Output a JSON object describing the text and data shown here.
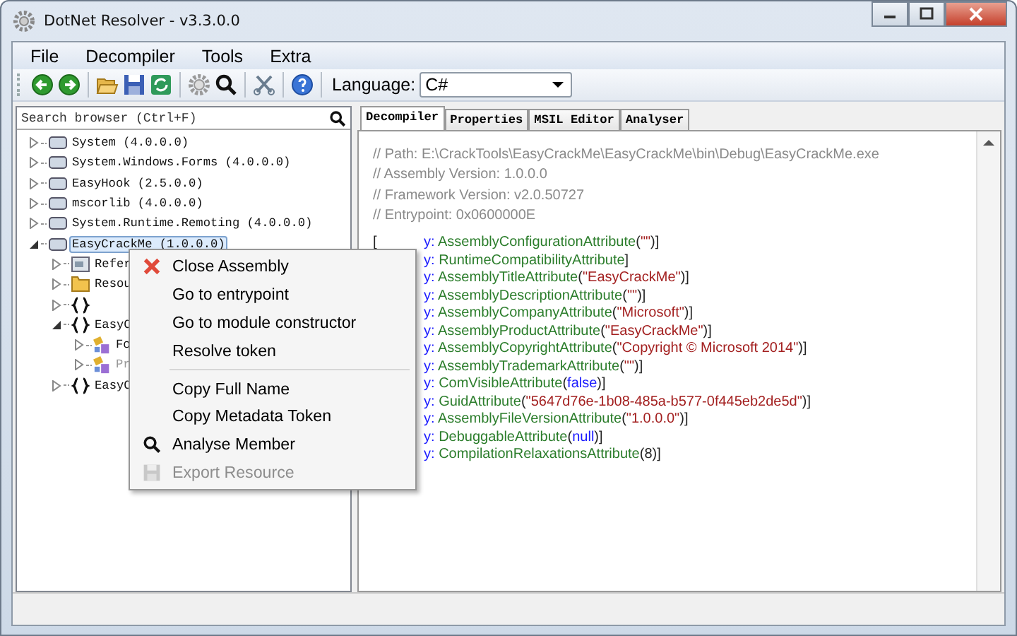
{
  "window": {
    "title": "DotNet Resolver - v3.3.0.0"
  },
  "menu_bar": [
    "File",
    "Decompiler",
    "Tools",
    "Extra"
  ],
  "toolbar": {
    "buttons": [
      {
        "kind": "back"
      },
      {
        "kind": "forward"
      },
      {
        "kind": "sep"
      },
      {
        "kind": "open"
      },
      {
        "kind": "save"
      },
      {
        "kind": "refresh"
      },
      {
        "kind": "sep"
      },
      {
        "kind": "settings"
      },
      {
        "kind": "search"
      },
      {
        "kind": "sep"
      },
      {
        "kind": "tools"
      },
      {
        "kind": "sep"
      },
      {
        "kind": "help"
      },
      {
        "kind": "sep"
      }
    ],
    "language_label": "Language:",
    "language_value": "C#"
  },
  "search": {
    "placeholder": "Search browser (Ctrl+F)"
  },
  "tree": [
    {
      "label": "System (4.0.0.0)",
      "kind": "assembly",
      "expanded": false,
      "selected": false
    },
    {
      "label": "System.Windows.Forms (4.0.0.0)",
      "kind": "assembly",
      "expanded": false,
      "selected": false
    },
    {
      "label": "EasyHook (2.5.0.0)",
      "kind": "assembly",
      "expanded": false,
      "selected": false
    },
    {
      "label": "mscorlib (4.0.0.0)",
      "kind": "assembly",
      "expanded": false,
      "selected": false
    },
    {
      "label": "System.Runtime.Remoting (4.0.0.0)",
      "kind": "assembly",
      "expanded": false,
      "selected": false
    },
    {
      "label": "EasyCrackMe (1.0.0.0)",
      "kind": "assembly",
      "expanded": true,
      "selected": true,
      "children": [
        {
          "label": "Refer",
          "kind": "references",
          "expanded": false,
          "selected": false
        },
        {
          "label": "Resou",
          "kind": "folder",
          "expanded": false,
          "selected": false
        },
        {
          "kind": "namespace",
          "expanded": false,
          "selected": false
        },
        {
          "label": "EasyC",
          "kind": "namespace",
          "expanded": true,
          "selected": false,
          "children": [
            {
              "label": "Fo",
              "kind": "class",
              "expanded": false,
              "selected": false,
              "dimmed": false
            },
            {
              "label": "Pr",
              "kind": "class",
              "expanded": false,
              "selected": false,
              "dimmed": true
            }
          ]
        },
        {
          "label": "EasyC",
          "kind": "namespace",
          "expanded": false,
          "selected": false
        }
      ]
    }
  ],
  "tabs": [
    {
      "label": "Decompiler",
      "selected": true
    },
    {
      "label": "Properties",
      "selected": false
    },
    {
      "label": "MSIL Editor",
      "selected": false
    },
    {
      "label": "Analyser",
      "selected": false
    }
  ],
  "comments": [
    "// Path: E:\\CrackTools\\EasyCrackMe\\EasyCrackMe\\bin\\Debug\\EasyCrackMe.exe",
    "// Assembly Version: 1.0.0.0",
    "// Framework Version: v2.0.50727",
    "// Entrypoint: 0x0600000E"
  ],
  "code_lines": [
    {
      "lead": "[",
      "tokens": [
        {
          "kind": "keyword",
          "text": "y: "
        },
        {
          "kind": "type",
          "text": "AssemblyConfigurationAttribute"
        },
        {
          "kind": "punct",
          "text": "("
        },
        {
          "kind": "string",
          "text": "\"\""
        },
        {
          "kind": "punct",
          "text": ")]"
        }
      ]
    },
    {
      "tokens": [
        {
          "kind": "keyword",
          "text": "y: "
        },
        {
          "kind": "type",
          "text": "RuntimeCompatibilityAttribute"
        },
        {
          "kind": "punct",
          "text": "]"
        }
      ]
    },
    {
      "tokens": [
        {
          "kind": "keyword",
          "text": "y: "
        },
        {
          "kind": "type",
          "text": "AssemblyTitleAttribute"
        },
        {
          "kind": "punct",
          "text": "("
        },
        {
          "kind": "string",
          "text": "\"EasyCrackMe\""
        },
        {
          "kind": "punct",
          "text": ")]"
        }
      ]
    },
    {
      "tokens": [
        {
          "kind": "keyword",
          "text": "y: "
        },
        {
          "kind": "type",
          "text": "AssemblyDescriptionAttribute"
        },
        {
          "kind": "punct",
          "text": "("
        },
        {
          "kind": "string",
          "text": "\"\""
        },
        {
          "kind": "punct",
          "text": ")]"
        }
      ]
    },
    {
      "tokens": [
        {
          "kind": "keyword",
          "text": "y: "
        },
        {
          "kind": "type",
          "text": "AssemblyCompanyAttribute"
        },
        {
          "kind": "punct",
          "text": "("
        },
        {
          "kind": "string",
          "text": "\"Microsoft\""
        },
        {
          "kind": "punct",
          "text": ")]"
        }
      ]
    },
    {
      "tokens": [
        {
          "kind": "keyword",
          "text": "y: "
        },
        {
          "kind": "type",
          "text": "AssemblyProductAttribute"
        },
        {
          "kind": "punct",
          "text": "("
        },
        {
          "kind": "string",
          "text": "\"EasyCrackMe\""
        },
        {
          "kind": "punct",
          "text": ")]"
        }
      ]
    },
    {
      "tokens": [
        {
          "kind": "keyword",
          "text": "y: "
        },
        {
          "kind": "type",
          "text": "AssemblyCopyrightAttribute"
        },
        {
          "kind": "punct",
          "text": "("
        },
        {
          "kind": "string",
          "text": "\"Copyright © Microsoft 2014\""
        },
        {
          "kind": "punct",
          "text": ")]"
        }
      ]
    },
    {
      "tokens": [
        {
          "kind": "keyword",
          "text": "y: "
        },
        {
          "kind": "type",
          "text": "AssemblyTrademarkAttribute"
        },
        {
          "kind": "punct",
          "text": "("
        },
        {
          "kind": "string",
          "text": "\"\""
        },
        {
          "kind": "punct",
          "text": ")]"
        }
      ]
    },
    {
      "tokens": [
        {
          "kind": "keyword",
          "text": "y: "
        },
        {
          "kind": "type",
          "text": "ComVisibleAttribute"
        },
        {
          "kind": "punct",
          "text": "("
        },
        {
          "kind": "keyword",
          "text": "false"
        },
        {
          "kind": "punct",
          "text": ")]"
        }
      ]
    },
    {
      "tokens": [
        {
          "kind": "keyword",
          "text": "y: "
        },
        {
          "kind": "type",
          "text": "GuidAttribute"
        },
        {
          "kind": "punct",
          "text": "("
        },
        {
          "kind": "string",
          "text": "\"5647d76e-1b08-485a-b577-0f445eb2de5d\""
        },
        {
          "kind": "punct",
          "text": ")]"
        }
      ]
    },
    {
      "tokens": [
        {
          "kind": "keyword",
          "text": "y: "
        },
        {
          "kind": "type",
          "text": "AssemblyFileVersionAttribute"
        },
        {
          "kind": "punct",
          "text": "("
        },
        {
          "kind": "string",
          "text": "\"1.0.0.0\""
        },
        {
          "kind": "punct",
          "text": ")]"
        }
      ]
    },
    {
      "tokens": [
        {
          "kind": "keyword",
          "text": "y: "
        },
        {
          "kind": "type",
          "text": "DebuggableAttribute"
        },
        {
          "kind": "punct",
          "text": "("
        },
        {
          "kind": "keyword",
          "text": "null"
        },
        {
          "kind": "punct",
          "text": ")]"
        }
      ]
    },
    {
      "tokens": [
        {
          "kind": "keyword",
          "text": "y: "
        },
        {
          "kind": "type",
          "text": "CompilationRelaxationsAttribute"
        },
        {
          "kind": "punct",
          "text": "(8)]"
        }
      ]
    }
  ],
  "context_menu": [
    {
      "kind": "close",
      "label": "Close Assembly",
      "disabled": false
    },
    {
      "kind": "plain",
      "label": "Go to entrypoint",
      "disabled": false
    },
    {
      "kind": "plain",
      "label": "Go to module constructor",
      "disabled": false
    },
    {
      "kind": "plain",
      "label": "Resolve token",
      "disabled": false
    },
    {
      "kind": "separator"
    },
    {
      "kind": "plain",
      "label": "Copy Full Name",
      "disabled": false
    },
    {
      "kind": "plain",
      "label": "Copy Metadata Token",
      "disabled": false
    },
    {
      "kind": "search",
      "label": "Analyse Member",
      "disabled": false
    },
    {
      "kind": "save",
      "label": "Export Resource",
      "disabled": true
    }
  ]
}
